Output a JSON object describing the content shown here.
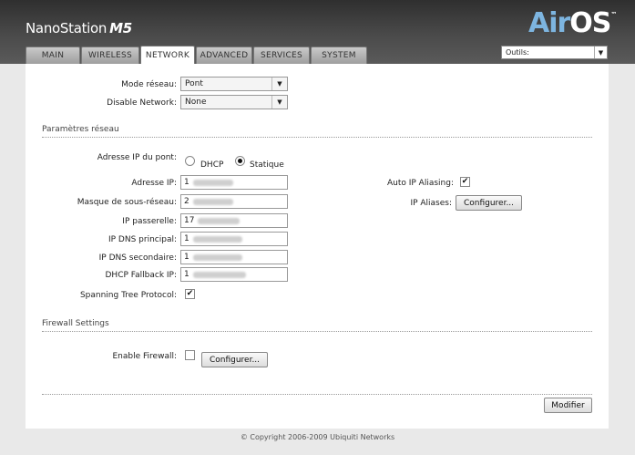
{
  "header": {
    "brand": "NanoStation",
    "model": "M5",
    "logo_air": "Air",
    "logo_os": "OS",
    "logo_tm": "™"
  },
  "tabs": [
    {
      "label": "MAIN"
    },
    {
      "label": "WIRELESS"
    },
    {
      "label": "NETWORK",
      "active": true
    },
    {
      "label": "ADVANCED"
    },
    {
      "label": "SERVICES"
    },
    {
      "label": "SYSTEM"
    }
  ],
  "tools": {
    "label": "Outils:"
  },
  "network": {
    "mode_label": "Mode réseau:",
    "mode_value": "Pont",
    "disable_label": "Disable Network:",
    "disable_value": "None"
  },
  "params": {
    "title": "Paramètres réseau",
    "bridge_ip_label": "Adresse IP du pont:",
    "dhcp_label": "DHCP",
    "static_label": "Statique",
    "ip_label": "Adresse IP:",
    "ip_value": "1",
    "mask_label": "Masque de sous-réseau:",
    "mask_value": "2",
    "gateway_label": "IP passerelle:",
    "gateway_value": "17",
    "dns1_label": "IP DNS principal:",
    "dns1_value": "1",
    "dns2_label": "IP DNS secondaire:",
    "dns2_value": "1",
    "fallback_label": "DHCP Fallback IP:",
    "fallback_value": "1",
    "stp_label": "Spanning Tree Protocol:",
    "auto_alias_label": "Auto IP Aliasing:",
    "ip_aliases_label": "IP Aliases:",
    "configure_label": "Configurer..."
  },
  "firewall": {
    "title": "Firewall Settings",
    "enable_label": "Enable Firewall:",
    "configure_label": "Configurer..."
  },
  "actions": {
    "modify_label": "Modifier"
  },
  "footer": {
    "copyright": "© Copyright 2006-2009 Ubiquiti Networks"
  },
  "icons": {
    "checkmark": "✔",
    "dropdown": "▼"
  }
}
